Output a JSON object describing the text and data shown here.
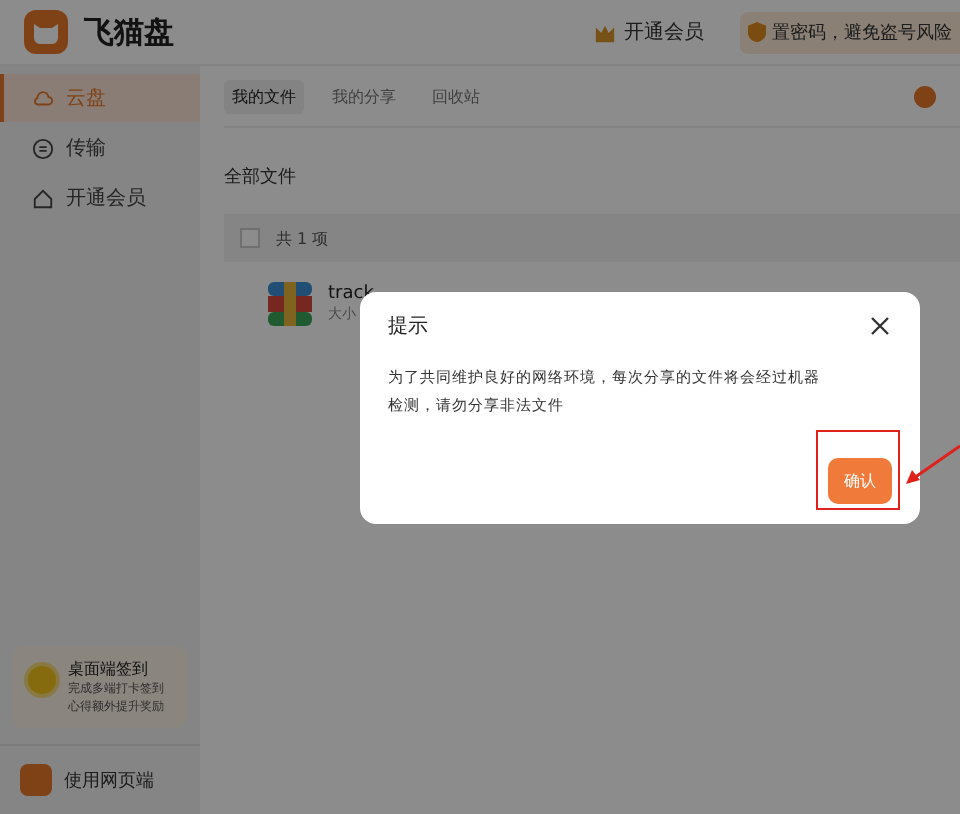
{
  "app": {
    "name": "飞猫盘"
  },
  "header": {
    "vip_label": "开通会员",
    "security_notice": "置密码，避免盗号风险"
  },
  "sidebar": {
    "items": [
      {
        "label": "云盘",
        "selected": true
      },
      {
        "label": "传输",
        "selected": false
      },
      {
        "label": "开通会员",
        "selected": false
      }
    ],
    "checkin_card": {
      "title": "桌面端签到",
      "lines": [
        "完成多端打卡签到",
        "心得额外提升奖励"
      ]
    },
    "web_link": {
      "label": "使用网页端"
    }
  },
  "tabs": [
    {
      "label": "我的文件",
      "selected": true
    },
    {
      "label": "我的分享",
      "selected": false
    },
    {
      "label": "回收站",
      "selected": false
    }
  ],
  "breadcrumb": "全部文件",
  "list": {
    "select_all_checked": false,
    "count": "共 1 项",
    "files": [
      {
        "name": "track",
        "meta": "大小"
      }
    ]
  },
  "dialog": {
    "title": "提示",
    "message": "为了共同维护良好的网络环境，每次分享的文件将会经过机器检测，请勿分享非法文件",
    "confirm": "确认"
  }
}
